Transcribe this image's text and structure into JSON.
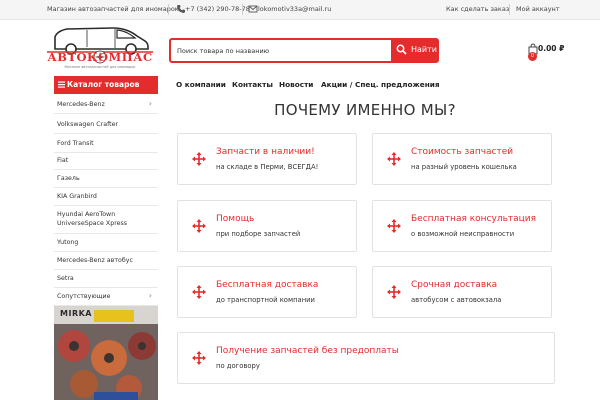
{
  "topbar": {
    "tagline": "Магазин автозапчастей для иномарок",
    "phone": "+7 (342) 290-78-78",
    "email": "lokomotiv33a@mail.ru",
    "how_to_order": "Как сделать заказ",
    "account": "Мой аккаунт"
  },
  "logo": {
    "text": "АВТОКОМПАС",
    "subtitle": "Магазин автозапчастей для иномарок"
  },
  "search": {
    "placeholder": "Поиск товара по названию",
    "button": "Найти"
  },
  "cart": {
    "count": "0",
    "total": "0.00 ₽"
  },
  "catalog": {
    "title": "Каталог товаров",
    "items": [
      {
        "label": "Mercedes-Benz",
        "has_children": true
      },
      {
        "label": "Volkswagen Crafter",
        "has_children": false
      },
      {
        "label": "Ford Transit",
        "has_children": false
      },
      {
        "label": "Fiat",
        "has_children": false
      },
      {
        "label": "Газель",
        "has_children": false
      },
      {
        "label": "KIA Granbird",
        "has_children": false
      },
      {
        "label": "Hyundai AeroTown UniverseSpace Xpress",
        "has_children": false
      },
      {
        "label": "Yutong",
        "has_children": false
      },
      {
        "label": "Mercedes-Benz автобус",
        "has_children": false
      },
      {
        "label": "Setra",
        "has_children": false
      },
      {
        "label": "Сопутствующие",
        "has_children": true
      }
    ]
  },
  "nav": {
    "items": [
      "О компании",
      "Контакты",
      "Новости",
      "Акции / Спец. предложения"
    ]
  },
  "why": {
    "title": "ПОЧЕМУ ИМЕННО МЫ?",
    "cards": [
      {
        "title": "Запчасти в наличии!",
        "desc": "на складе в Перми, ВСЕГДА!"
      },
      {
        "title": "Стоимость запчастей",
        "desc": "на разный уровень кошелька"
      },
      {
        "title": "Помощь",
        "desc": "при подборе запчастей"
      },
      {
        "title": "Бесплатная консультация",
        "desc": "о возможной неисправности"
      },
      {
        "title": "Бесплатная доставка",
        "desc": "до транспортной компании"
      },
      {
        "title": "Срочная доставка",
        "desc": "автобусом с автовокзала"
      },
      {
        "title": "Получение запчастей без предоплаты",
        "desc": "по договору"
      }
    ]
  },
  "promo": {
    "brand": "MIRKA"
  },
  "colors": {
    "accent": "#e32c2c",
    "topbar_bg": "#f5f5f5",
    "border": "#e2e2e2"
  }
}
